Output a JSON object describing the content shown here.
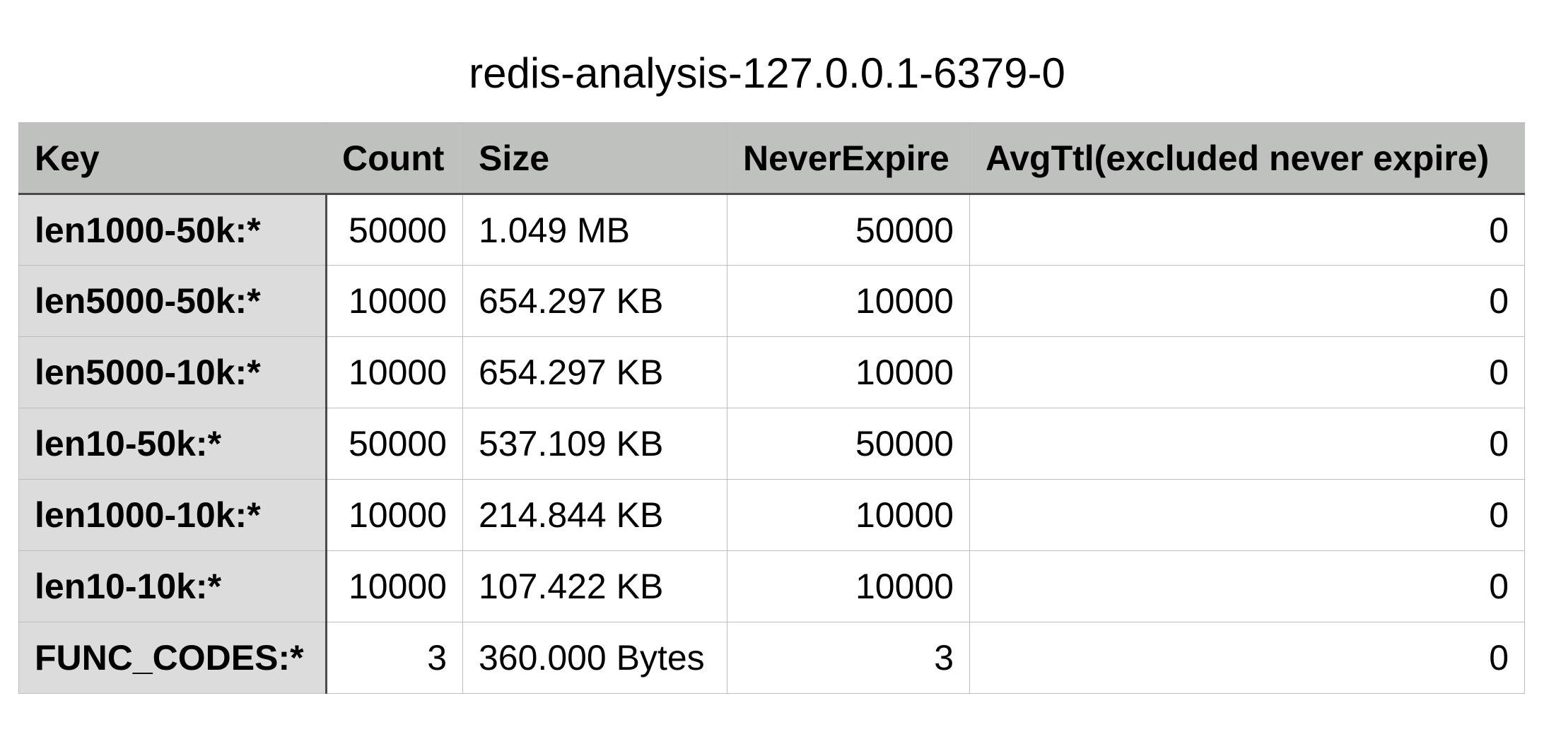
{
  "title": "redis-analysis-127.0.0.1-6379-0",
  "table": {
    "headers": [
      "Key",
      "Count",
      "Size",
      "NeverExpire",
      "AvgTtl(excluded never expire)"
    ],
    "rows": [
      [
        "len1000-50k:*",
        "50000",
        "1.049 MB",
        "50000",
        "0"
      ],
      [
        "len5000-50k:*",
        "10000",
        "654.297 KB",
        "10000",
        "0"
      ],
      [
        "len5000-10k:*",
        "10000",
        "654.297 KB",
        "10000",
        "0"
      ],
      [
        "len10-50k:*",
        "50000",
        "537.109 KB",
        "50000",
        "0"
      ],
      [
        "len1000-10k:*",
        "10000",
        "214.844 KB",
        "10000",
        "0"
      ],
      [
        "len10-10k:*",
        "10000",
        "107.422 KB",
        "10000",
        "0"
      ],
      [
        "FUNC_CODES:*",
        "3",
        "360.000 Bytes",
        "3",
        "0"
      ]
    ]
  }
}
